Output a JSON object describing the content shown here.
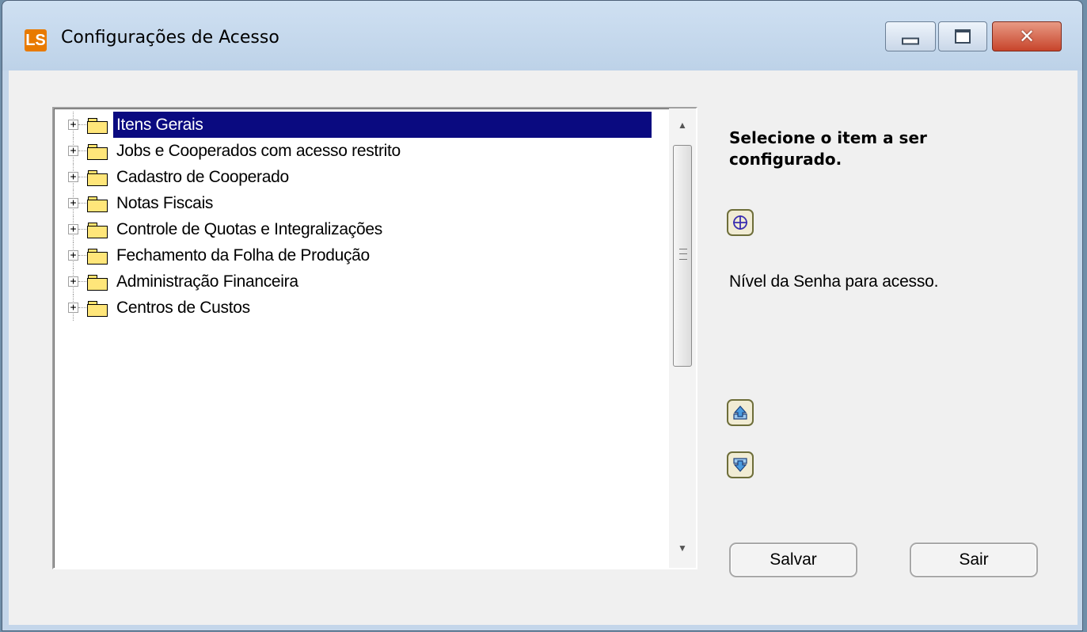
{
  "window": {
    "title": "Configurações de Acesso",
    "app_icon_text": "LS",
    "close_glyph": "✕"
  },
  "tree": {
    "items": [
      {
        "label": "Itens Gerais",
        "selected": true,
        "expander": "+"
      },
      {
        "label": "Jobs e Cooperados com acesso restrito",
        "expander": "+"
      },
      {
        "label": "Cadastro de Cooperado",
        "expander": "+"
      },
      {
        "label": "Notas Fiscais",
        "expander": "+"
      },
      {
        "label": "Controle de Quotas e Integralizações",
        "expander": "+"
      },
      {
        "label": "Fechamento da Folha de Produção",
        "expander": "+"
      },
      {
        "label": "Administração Financeira",
        "expander": "+"
      },
      {
        "label": "Centros de Custos",
        "expander": "+"
      }
    ],
    "scroll_up_glyph": "▲",
    "scroll_down_glyph": "▼"
  },
  "panel": {
    "prompt": "Selecione o item a ser configurado.",
    "level_label": "Nível da Senha para acesso.",
    "icons": [
      "crosshair-icon",
      "move-up-icon",
      "move-down-icon"
    ]
  },
  "buttons": {
    "save": "Salvar",
    "exit": "Sair"
  },
  "colors": {
    "selection": "#0a0a80",
    "titlebar": "#c4d6ea",
    "folder": "#ffe67a"
  }
}
